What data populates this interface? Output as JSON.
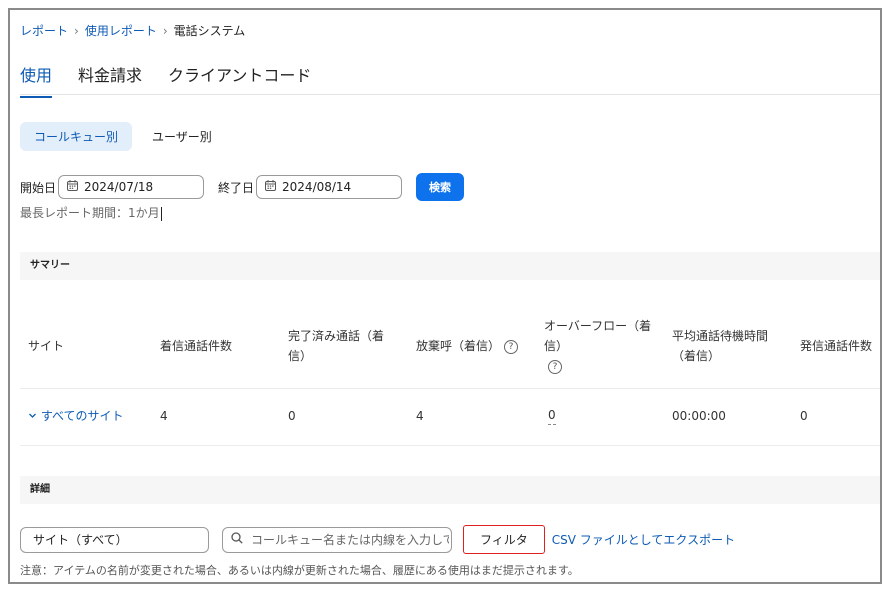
{
  "breadcrumb": {
    "items": [
      "レポート",
      "使用レポート"
    ],
    "current": "電話システム",
    "separator": "›"
  },
  "tabs": [
    "使用",
    "料金請求",
    "クライアントコード"
  ],
  "active_tab": "使用",
  "segment": {
    "active": "コールキュー別",
    "inactive": "ユーザー別"
  },
  "dates": {
    "start_label": "開始日",
    "start_value": "2024/07/18",
    "end_label": "終了日",
    "end_value": "2024/08/14",
    "search_button": "検索",
    "max_period_note": "最長レポート期間：1か月"
  },
  "summary": {
    "title": "サマリー",
    "columns": {
      "site": "サイト",
      "incoming": "着信通話件数",
      "completed_line1": "完了済み通話（着",
      "completed_line2": "信）",
      "abandoned": "放棄呼（着信）",
      "overflow_line1": "オーバーフロー（着",
      "overflow_line2": "信）",
      "avg_wait_line1": "平均通話待機時間",
      "avg_wait_line2": "（着信）",
      "outgoing": "発信通話件数"
    },
    "row": {
      "site": "すべてのサイト",
      "incoming": "4",
      "completed": "0",
      "abandoned": "4",
      "overflow": "0",
      "avg_wait": "00:00:00",
      "outgoing": "0"
    }
  },
  "details": {
    "title": "詳細",
    "site_select": "サイト（すべて）",
    "search_placeholder": "コールキュー名または内線を入力して",
    "filter_button": "フィルタ",
    "export_link": "CSV ファイルとしてエクスポート",
    "note": "注意：アイテムの名前が変更された場合、あるいは内線が更新された場合、履歴にある使用はまだ提示されます。"
  },
  "icons": {
    "calendar": "calendar-icon",
    "search": "search-icon",
    "chevron": "chevron-down-icon",
    "help": "question-circle-icon"
  },
  "colors": {
    "accent": "#0e72ed",
    "link": "#0e5bb5",
    "highlight_border": "#e02020"
  }
}
